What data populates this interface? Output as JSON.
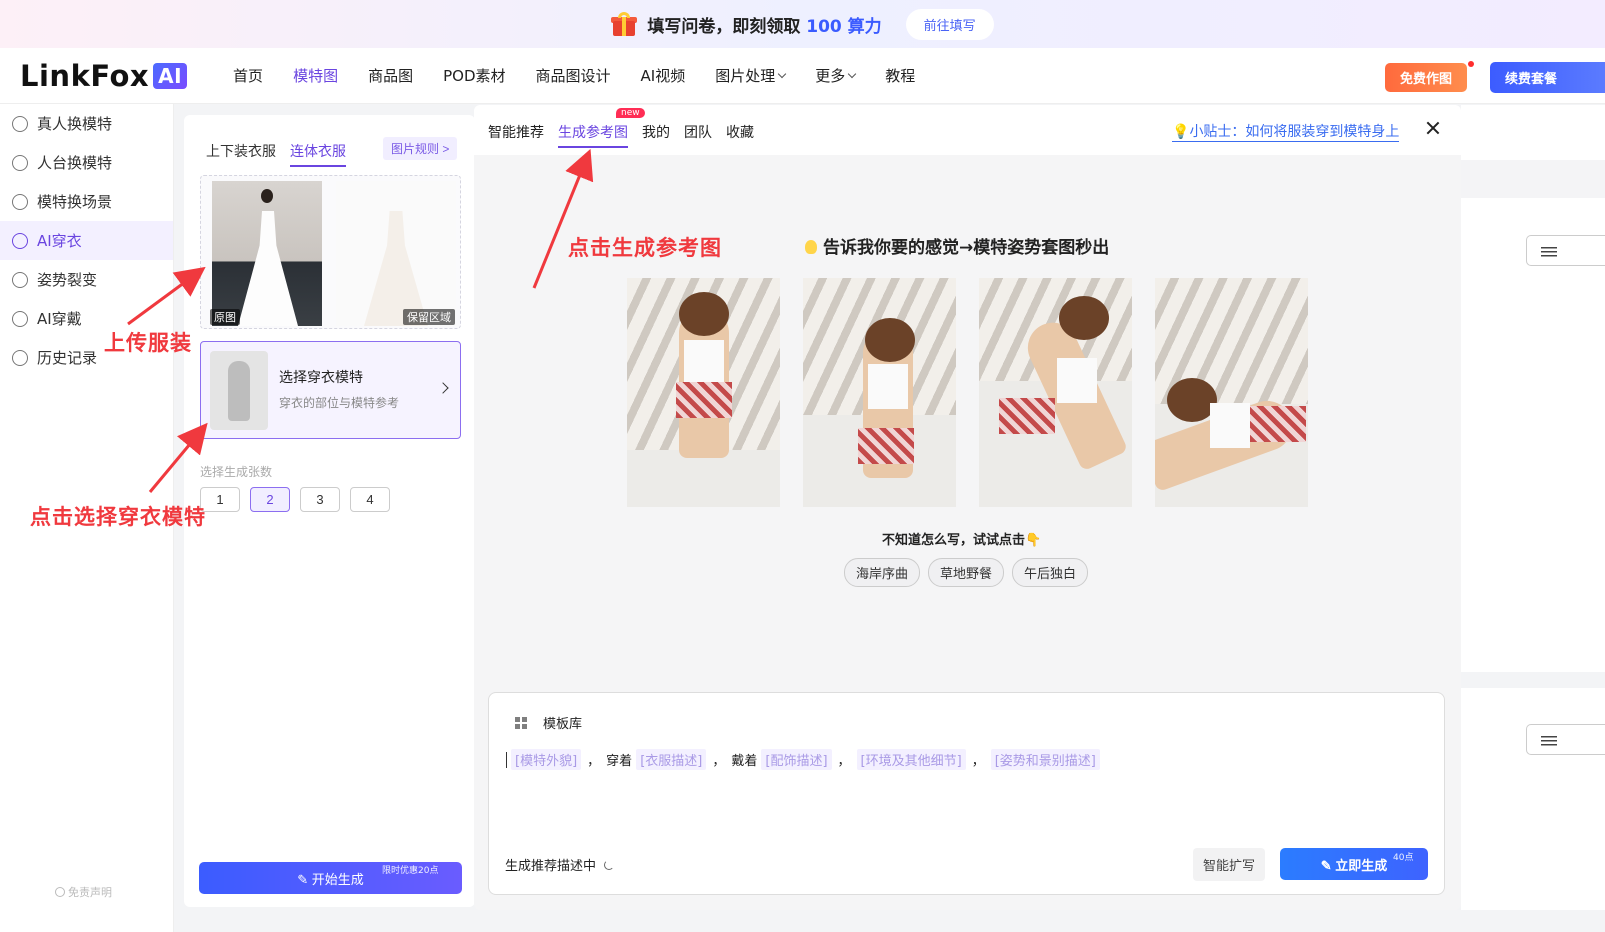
{
  "banner": {
    "text_before": "填写问卷，即刻领取 ",
    "highlight": "100 算力",
    "button": "前往填写"
  },
  "header": {
    "logo_text": "LinkFox",
    "logo_badge": "AI",
    "nav": [
      {
        "label": "首页",
        "active": false,
        "dropdown": false
      },
      {
        "label": "模特图",
        "active": true,
        "dropdown": false
      },
      {
        "label": "商品图",
        "active": false,
        "dropdown": false
      },
      {
        "label": "POD素材",
        "active": false,
        "dropdown": false
      },
      {
        "label": "商品图设计",
        "active": false,
        "dropdown": false
      },
      {
        "label": "AI视频",
        "active": false,
        "dropdown": false
      },
      {
        "label": "图片处理",
        "active": false,
        "dropdown": true
      },
      {
        "label": "更多",
        "active": false,
        "dropdown": true
      },
      {
        "label": "教程",
        "active": false,
        "dropdown": false
      }
    ],
    "free_button": "免费作图",
    "renew_button": "续费套餐"
  },
  "sidebar": {
    "items": [
      {
        "label": "真人换模特",
        "active": false
      },
      {
        "label": "人台换模特",
        "active": false
      },
      {
        "label": "模特换场景",
        "active": false
      },
      {
        "label": "AI穿衣",
        "active": true
      },
      {
        "label": "姿势裂变",
        "active": false
      },
      {
        "label": "AI穿戴",
        "active": false
      },
      {
        "label": "历史记录",
        "active": false
      }
    ],
    "footer": "免责声明"
  },
  "config": {
    "tabs": [
      {
        "label": "上下装衣服",
        "active": false
      },
      {
        "label": "连体衣服",
        "active": true
      }
    ],
    "rule_button": "图片规则",
    "photo_original_tag": "原图",
    "photo_keep_tag": "保留区域",
    "model_title": "选择穿衣模特",
    "model_subtitle": "穿衣的部位与模特参考",
    "count_label": "选择生成张数",
    "counts": [
      "1",
      "2",
      "3",
      "4"
    ],
    "selected_count": "2",
    "start_button": "开始生成",
    "start_badge": "限时优惠20点"
  },
  "modal": {
    "tabs": [
      {
        "label": "智能推荐",
        "active": false
      },
      {
        "label": "生成参考图",
        "active": true
      },
      {
        "label": "我的",
        "active": false
      },
      {
        "label": "团队",
        "active": false
      },
      {
        "label": "收藏",
        "active": false
      }
    ],
    "new_badge": "new",
    "tip_link": "小贴士：如何将服装穿到模特身上",
    "headline": "告诉我你要的感觉→模特姿势套图秒出",
    "hint": "不知道怎么写，试试点击👇",
    "pills": [
      "海岸序曲",
      "草地野餐",
      "午后独白"
    ],
    "template_label": "模板库",
    "prompt": {
      "slot1": "[模特外貌]",
      "sep1": "，",
      "word1": "穿着",
      "slot2": "[衣服描述]",
      "sep2": "，",
      "word2": "戴着",
      "slot3": "[配饰描述]",
      "sep3": "，",
      "slot4": "[环境及其他细节]",
      "sep4": "，",
      "slot5": "[姿势和景别描述]"
    },
    "status": "生成推荐描述中",
    "expand_button": "智能扩写",
    "generate_button": "立即生成",
    "generate_badge": "40点"
  },
  "annotations": {
    "upload": "上传服装",
    "select_model": "点击选择穿衣模特",
    "generate_ref": "点击生成参考图"
  },
  "colors": {
    "accent": "#6a45e0",
    "annotation": "#f0393e",
    "primary_button": "#3b5cff"
  }
}
